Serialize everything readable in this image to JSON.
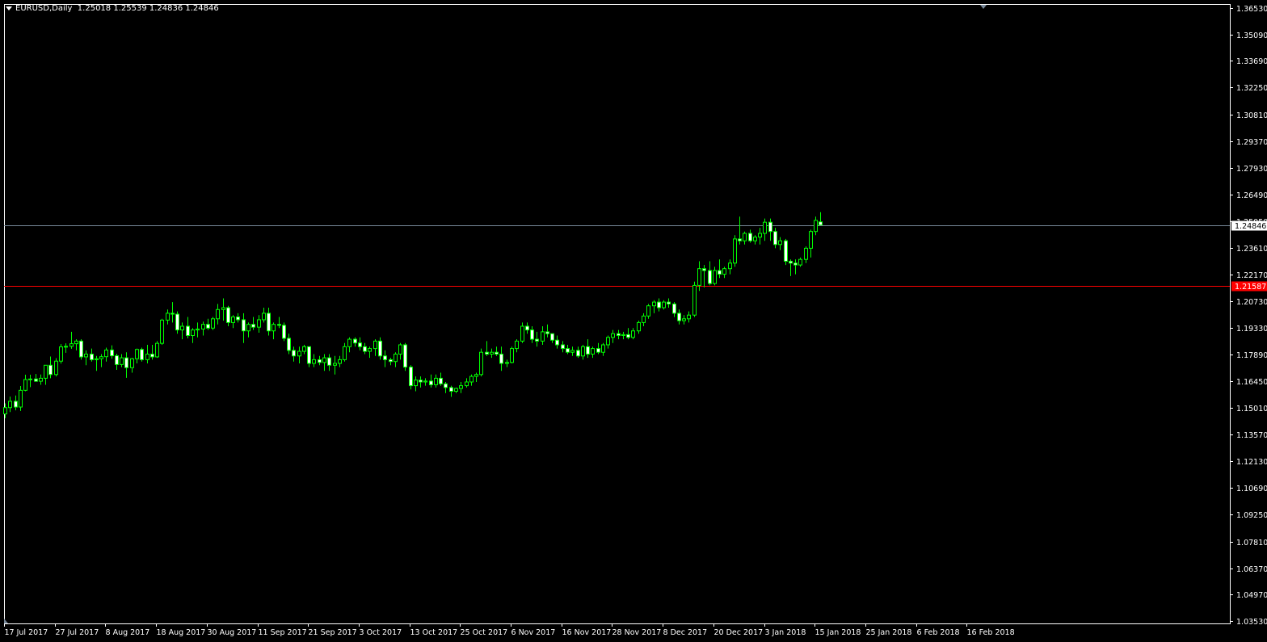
{
  "header": {
    "symbol": "EURUSD,Daily",
    "ohlc": "1.25018 1.25539 1.24836 1.24846"
  },
  "colors": {
    "background": "#000000",
    "frame": "#ffffff",
    "candle_up_fill": "#000000",
    "candle_down_fill": "#ffffff",
    "candle_outline": "#00ff00",
    "bid_line": "#778899",
    "level_line": "#ff0000",
    "level_label_bg": "#ff0000",
    "bid_label_bg": "#ffffff"
  },
  "chart_data": {
    "type": "candlestick",
    "title": "",
    "xlabel": "",
    "ylabel": "",
    "ylim": [
      1.0353,
      1.3653
    ],
    "grid": false,
    "y_ticks": [
      "1.36530",
      "1.35090",
      "1.33690",
      "1.32250",
      "1.30810",
      "1.29370",
      "1.27930",
      "1.26490",
      "1.25050",
      "1.23610",
      "1.22170",
      "1.20730",
      "1.19330",
      "1.17890",
      "1.16450",
      "1.15010",
      "1.13570",
      "1.12130",
      "1.10690",
      "1.09250",
      "1.07810",
      "1.06370",
      "1.04970",
      "1.03530"
    ],
    "x_ticks": [
      "17 Jul 2017",
      "27 Jul 2017",
      "8 Aug 2017",
      "18 Aug 2017",
      "30 Aug 2017",
      "11 Sep 2017",
      "21 Sep 2017",
      "3 Oct 2017",
      "13 Oct 2017",
      "25 Oct 2017",
      "6 Nov 2017",
      "16 Nov 2017",
      "28 Nov 2017",
      "8 Dec 2017",
      "20 Dec 2017",
      "3 Jan 2018",
      "15 Jan 2018",
      "25 Jan 2018",
      "6 Feb 2018",
      "16 Feb 2018"
    ],
    "bid_line": {
      "value": 1.24846,
      "label": "1.24846"
    },
    "level_line": {
      "value": 1.21587,
      "label": "1.21587"
    },
    "candles": [
      {
        "o": 1.1468,
        "h": 1.1525,
        "l": 1.1445,
        "c": 1.1502
      },
      {
        "o": 1.1502,
        "h": 1.1561,
        "l": 1.1478,
        "c": 1.1536
      },
      {
        "o": 1.1536,
        "h": 1.1567,
        "l": 1.1487,
        "c": 1.1505
      },
      {
        "o": 1.1505,
        "h": 1.1618,
        "l": 1.1484,
        "c": 1.1595
      },
      {
        "o": 1.1595,
        "h": 1.1679,
        "l": 1.159,
        "c": 1.1653
      },
      {
        "o": 1.1653,
        "h": 1.1679,
        "l": 1.1612,
        "c": 1.1656
      },
      {
        "o": 1.1656,
        "h": 1.1683,
        "l": 1.164,
        "c": 1.1644
      },
      {
        "o": 1.1644,
        "h": 1.168,
        "l": 1.1625,
        "c": 1.166
      },
      {
        "o": 1.166,
        "h": 1.1722,
        "l": 1.1625,
        "c": 1.173
      },
      {
        "o": 1.173,
        "h": 1.1777,
        "l": 1.166,
        "c": 1.168
      },
      {
        "o": 1.168,
        "h": 1.1768,
        "l": 1.167,
        "c": 1.1752
      },
      {
        "o": 1.1752,
        "h": 1.1844,
        "l": 1.1739,
        "c": 1.1829
      },
      {
        "o": 1.1829,
        "h": 1.1848,
        "l": 1.1797,
        "c": 1.1832
      },
      {
        "o": 1.1832,
        "h": 1.191,
        "l": 1.1819,
        "c": 1.1846
      },
      {
        "o": 1.1846,
        "h": 1.187,
        "l": 1.181,
        "c": 1.186
      },
      {
        "o": 1.186,
        "h": 1.187,
        "l": 1.176,
        "c": 1.1775
      },
      {
        "o": 1.1775,
        "h": 1.181,
        "l": 1.173,
        "c": 1.179
      },
      {
        "o": 1.179,
        "h": 1.182,
        "l": 1.175,
        "c": 1.176
      },
      {
        "o": 1.176,
        "h": 1.178,
        "l": 1.17,
        "c": 1.1765
      },
      {
        "o": 1.1765,
        "h": 1.179,
        "l": 1.172,
        "c": 1.1776
      },
      {
        "o": 1.1776,
        "h": 1.1825,
        "l": 1.175,
        "c": 1.1812
      },
      {
        "o": 1.1812,
        "h": 1.1837,
        "l": 1.1765,
        "c": 1.1781
      },
      {
        "o": 1.1781,
        "h": 1.1792,
        "l": 1.1705,
        "c": 1.1734
      },
      {
        "o": 1.1734,
        "h": 1.179,
        "l": 1.172,
        "c": 1.177
      },
      {
        "o": 1.177,
        "h": 1.18,
        "l": 1.1662,
        "c": 1.1717
      },
      {
        "o": 1.1717,
        "h": 1.177,
        "l": 1.169,
        "c": 1.1765
      },
      {
        "o": 1.1765,
        "h": 1.182,
        "l": 1.174,
        "c": 1.1815
      },
      {
        "o": 1.1815,
        "h": 1.1825,
        "l": 1.175,
        "c": 1.176
      },
      {
        "o": 1.176,
        "h": 1.184,
        "l": 1.174,
        "c": 1.179
      },
      {
        "o": 1.179,
        "h": 1.184,
        "l": 1.176,
        "c": 1.1775
      },
      {
        "o": 1.1775,
        "h": 1.186,
        "l": 1.177,
        "c": 1.1848
      },
      {
        "o": 1.1848,
        "h": 1.198,
        "l": 1.184,
        "c": 1.1973
      },
      {
        "o": 1.1973,
        "h": 1.203,
        "l": 1.195,
        "c": 1.201
      },
      {
        "o": 1.201,
        "h": 1.207,
        "l": 1.196,
        "c": 1.2005
      },
      {
        "o": 1.2005,
        "h": 1.202,
        "l": 1.19,
        "c": 1.192
      },
      {
        "o": 1.192,
        "h": 1.196,
        "l": 1.187,
        "c": 1.194
      },
      {
        "o": 1.194,
        "h": 1.199,
        "l": 1.1875,
        "c": 1.189
      },
      {
        "o": 1.189,
        "h": 1.193,
        "l": 1.185,
        "c": 1.192
      },
      {
        "o": 1.192,
        "h": 1.196,
        "l": 1.188,
        "c": 1.1925
      },
      {
        "o": 1.1925,
        "h": 1.1965,
        "l": 1.189,
        "c": 1.195
      },
      {
        "o": 1.195,
        "h": 1.198,
        "l": 1.192,
        "c": 1.193
      },
      {
        "o": 1.193,
        "h": 1.199,
        "l": 1.192,
        "c": 1.198
      },
      {
        "o": 1.198,
        "h": 1.206,
        "l": 1.195,
        "c": 1.203
      },
      {
        "o": 1.203,
        "h": 1.209,
        "l": 1.197,
        "c": 1.204
      },
      {
        "o": 1.204,
        "h": 1.205,
        "l": 1.194,
        "c": 1.196
      },
      {
        "o": 1.196,
        "h": 1.2,
        "l": 1.193,
        "c": 1.199
      },
      {
        "o": 1.199,
        "h": 1.201,
        "l": 1.196,
        "c": 1.1975
      },
      {
        "o": 1.1975,
        "h": 1.201,
        "l": 1.185,
        "c": 1.1915
      },
      {
        "o": 1.1915,
        "h": 1.196,
        "l": 1.188,
        "c": 1.195
      },
      {
        "o": 1.195,
        "h": 1.199,
        "l": 1.192,
        "c": 1.1935
      },
      {
        "o": 1.1935,
        "h": 1.2,
        "l": 1.1905,
        "c": 1.1975
      },
      {
        "o": 1.1975,
        "h": 1.204,
        "l": 1.196,
        "c": 1.201
      },
      {
        "o": 1.201,
        "h": 1.204,
        "l": 1.189,
        "c": 1.1915
      },
      {
        "o": 1.1915,
        "h": 1.196,
        "l": 1.187,
        "c": 1.195
      },
      {
        "o": 1.195,
        "h": 1.199,
        "l": 1.193,
        "c": 1.1945
      },
      {
        "o": 1.1945,
        "h": 1.196,
        "l": 1.186,
        "c": 1.1875
      },
      {
        "o": 1.1875,
        "h": 1.19,
        "l": 1.179,
        "c": 1.181
      },
      {
        "o": 1.181,
        "h": 1.183,
        "l": 1.175,
        "c": 1.178
      },
      {
        "o": 1.178,
        "h": 1.183,
        "l": 1.174,
        "c": 1.1805
      },
      {
        "o": 1.1805,
        "h": 1.184,
        "l": 1.179,
        "c": 1.183
      },
      {
        "o": 1.183,
        "h": 1.183,
        "l": 1.172,
        "c": 1.174
      },
      {
        "o": 1.174,
        "h": 1.179,
        "l": 1.172,
        "c": 1.176
      },
      {
        "o": 1.176,
        "h": 1.178,
        "l": 1.173,
        "c": 1.1745
      },
      {
        "o": 1.1745,
        "h": 1.179,
        "l": 1.17,
        "c": 1.177
      },
      {
        "o": 1.177,
        "h": 1.179,
        "l": 1.17,
        "c": 1.173
      },
      {
        "o": 1.173,
        "h": 1.178,
        "l": 1.168,
        "c": 1.174
      },
      {
        "o": 1.174,
        "h": 1.178,
        "l": 1.172,
        "c": 1.176
      },
      {
        "o": 1.176,
        "h": 1.185,
        "l": 1.175,
        "c": 1.183
      },
      {
        "o": 1.183,
        "h": 1.188,
        "l": 1.18,
        "c": 1.187
      },
      {
        "o": 1.187,
        "h": 1.188,
        "l": 1.183,
        "c": 1.185
      },
      {
        "o": 1.185,
        "h": 1.188,
        "l": 1.181,
        "c": 1.183
      },
      {
        "o": 1.183,
        "h": 1.185,
        "l": 1.179,
        "c": 1.1805
      },
      {
        "o": 1.1805,
        "h": 1.183,
        "l": 1.177,
        "c": 1.182
      },
      {
        "o": 1.182,
        "h": 1.187,
        "l": 1.178,
        "c": 1.186
      },
      {
        "o": 1.186,
        "h": 1.188,
        "l": 1.176,
        "c": 1.178
      },
      {
        "o": 1.178,
        "h": 1.181,
        "l": 1.172,
        "c": 1.176
      },
      {
        "o": 1.176,
        "h": 1.177,
        "l": 1.173,
        "c": 1.175
      },
      {
        "o": 1.175,
        "h": 1.18,
        "l": 1.172,
        "c": 1.179
      },
      {
        "o": 1.179,
        "h": 1.185,
        "l": 1.176,
        "c": 1.184
      },
      {
        "o": 1.184,
        "h": 1.185,
        "l": 1.17,
        "c": 1.172
      },
      {
        "o": 1.172,
        "h": 1.173,
        "l": 1.16,
        "c": 1.162
      },
      {
        "o": 1.162,
        "h": 1.167,
        "l": 1.159,
        "c": 1.165
      },
      {
        "o": 1.165,
        "h": 1.167,
        "l": 1.161,
        "c": 1.164
      },
      {
        "o": 1.164,
        "h": 1.166,
        "l": 1.162,
        "c": 1.1645
      },
      {
        "o": 1.1645,
        "h": 1.168,
        "l": 1.161,
        "c": 1.1625
      },
      {
        "o": 1.1625,
        "h": 1.168,
        "l": 1.161,
        "c": 1.166
      },
      {
        "o": 1.166,
        "h": 1.169,
        "l": 1.162,
        "c": 1.163
      },
      {
        "o": 1.163,
        "h": 1.164,
        "l": 1.158,
        "c": 1.161
      },
      {
        "o": 1.161,
        "h": 1.162,
        "l": 1.156,
        "c": 1.159
      },
      {
        "o": 1.159,
        "h": 1.161,
        "l": 1.158,
        "c": 1.1605
      },
      {
        "o": 1.1605,
        "h": 1.164,
        "l": 1.158,
        "c": 1.162
      },
      {
        "o": 1.162,
        "h": 1.166,
        "l": 1.161,
        "c": 1.164
      },
      {
        "o": 1.164,
        "h": 1.168,
        "l": 1.162,
        "c": 1.167
      },
      {
        "o": 1.167,
        "h": 1.169,
        "l": 1.164,
        "c": 1.168
      },
      {
        "o": 1.168,
        "h": 1.182,
        "l": 1.167,
        "c": 1.18
      },
      {
        "o": 1.18,
        "h": 1.186,
        "l": 1.178,
        "c": 1.179
      },
      {
        "o": 1.179,
        "h": 1.182,
        "l": 1.177,
        "c": 1.18
      },
      {
        "o": 1.18,
        "h": 1.183,
        "l": 1.178,
        "c": 1.179
      },
      {
        "o": 1.179,
        "h": 1.183,
        "l": 1.17,
        "c": 1.174
      },
      {
        "o": 1.174,
        "h": 1.176,
        "l": 1.172,
        "c": 1.1745
      },
      {
        "o": 1.1745,
        "h": 1.183,
        "l": 1.174,
        "c": 1.182
      },
      {
        "o": 1.182,
        "h": 1.187,
        "l": 1.18,
        "c": 1.186
      },
      {
        "o": 1.186,
        "h": 1.196,
        "l": 1.185,
        "c": 1.194
      },
      {
        "o": 1.194,
        "h": 1.196,
        "l": 1.19,
        "c": 1.192
      },
      {
        "o": 1.192,
        "h": 1.194,
        "l": 1.185,
        "c": 1.187
      },
      {
        "o": 1.187,
        "h": 1.191,
        "l": 1.183,
        "c": 1.186
      },
      {
        "o": 1.186,
        "h": 1.194,
        "l": 1.184,
        "c": 1.191
      },
      {
        "o": 1.191,
        "h": 1.195,
        "l": 1.188,
        "c": 1.19
      },
      {
        "o": 1.19,
        "h": 1.19,
        "l": 1.185,
        "c": 1.1865
      },
      {
        "o": 1.1865,
        "h": 1.189,
        "l": 1.182,
        "c": 1.184
      },
      {
        "o": 1.184,
        "h": 1.186,
        "l": 1.18,
        "c": 1.182
      },
      {
        "o": 1.182,
        "h": 1.184,
        "l": 1.179,
        "c": 1.18
      },
      {
        "o": 1.18,
        "h": 1.183,
        "l": 1.178,
        "c": 1.181
      },
      {
        "o": 1.181,
        "h": 1.183,
        "l": 1.177,
        "c": 1.178
      },
      {
        "o": 1.178,
        "h": 1.184,
        "l": 1.176,
        "c": 1.183
      },
      {
        "o": 1.183,
        "h": 1.187,
        "l": 1.177,
        "c": 1.179
      },
      {
        "o": 1.179,
        "h": 1.183,
        "l": 1.177,
        "c": 1.182
      },
      {
        "o": 1.182,
        "h": 1.185,
        "l": 1.179,
        "c": 1.18
      },
      {
        "o": 1.18,
        "h": 1.185,
        "l": 1.178,
        "c": 1.184
      },
      {
        "o": 1.184,
        "h": 1.189,
        "l": 1.182,
        "c": 1.188
      },
      {
        "o": 1.188,
        "h": 1.192,
        "l": 1.185,
        "c": 1.19
      },
      {
        "o": 1.19,
        "h": 1.192,
        "l": 1.187,
        "c": 1.189
      },
      {
        "o": 1.189,
        "h": 1.191,
        "l": 1.187,
        "c": 1.1895
      },
      {
        "o": 1.1895,
        "h": 1.193,
        "l": 1.187,
        "c": 1.188
      },
      {
        "o": 1.188,
        "h": 1.193,
        "l": 1.187,
        "c": 1.1915
      },
      {
        "o": 1.1915,
        "h": 1.197,
        "l": 1.19,
        "c": 1.196
      },
      {
        "o": 1.196,
        "h": 1.201,
        "l": 1.194,
        "c": 1.1995
      },
      {
        "o": 1.1995,
        "h": 1.206,
        "l": 1.198,
        "c": 1.205
      },
      {
        "o": 1.205,
        "h": 1.208,
        "l": 1.201,
        "c": 1.207
      },
      {
        "o": 1.207,
        "h": 1.209,
        "l": 1.202,
        "c": 1.204
      },
      {
        "o": 1.204,
        "h": 1.208,
        "l": 1.203,
        "c": 1.207
      },
      {
        "o": 1.207,
        "h": 1.209,
        "l": 1.204,
        "c": 1.206
      },
      {
        "o": 1.206,
        "h": 1.207,
        "l": 1.199,
        "c": 1.201
      },
      {
        "o": 1.201,
        "h": 1.203,
        "l": 1.195,
        "c": 1.197
      },
      {
        "o": 1.197,
        "h": 1.2,
        "l": 1.195,
        "c": 1.198
      },
      {
        "o": 1.198,
        "h": 1.202,
        "l": 1.196,
        "c": 1.2
      },
      {
        "o": 1.2,
        "h": 1.218,
        "l": 1.199,
        "c": 1.216
      },
      {
        "o": 1.216,
        "h": 1.229,
        "l": 1.213,
        "c": 1.225
      },
      {
        "o": 1.225,
        "h": 1.227,
        "l": 1.215,
        "c": 1.224
      },
      {
        "o": 1.224,
        "h": 1.229,
        "l": 1.216,
        "c": 1.217
      },
      {
        "o": 1.217,
        "h": 1.226,
        "l": 1.216,
        "c": 1.224
      },
      {
        "o": 1.224,
        "h": 1.23,
        "l": 1.22,
        "c": 1.222
      },
      {
        "o": 1.222,
        "h": 1.226,
        "l": 1.22,
        "c": 1.225
      },
      {
        "o": 1.225,
        "h": 1.23,
        "l": 1.222,
        "c": 1.228
      },
      {
        "o": 1.228,
        "h": 1.243,
        "l": 1.226,
        "c": 1.241
      },
      {
        "o": 1.241,
        "h": 1.253,
        "l": 1.238,
        "c": 1.24
      },
      {
        "o": 1.24,
        "h": 1.245,
        "l": 1.238,
        "c": 1.244
      },
      {
        "o": 1.244,
        "h": 1.246,
        "l": 1.239,
        "c": 1.24
      },
      {
        "o": 1.24,
        "h": 1.243,
        "l": 1.238,
        "c": 1.242
      },
      {
        "o": 1.242,
        "h": 1.247,
        "l": 1.238,
        "c": 1.244
      },
      {
        "o": 1.244,
        "h": 1.252,
        "l": 1.24,
        "c": 1.25
      },
      {
        "o": 1.25,
        "h": 1.252,
        "l": 1.24,
        "c": 1.245
      },
      {
        "o": 1.245,
        "h": 1.247,
        "l": 1.236,
        "c": 1.238
      },
      {
        "o": 1.238,
        "h": 1.242,
        "l": 1.235,
        "c": 1.24
      },
      {
        "o": 1.24,
        "h": 1.241,
        "l": 1.227,
        "c": 1.229
      },
      {
        "o": 1.229,
        "h": 1.23,
        "l": 1.221,
        "c": 1.228
      },
      {
        "o": 1.228,
        "h": 1.23,
        "l": 1.222,
        "c": 1.227
      },
      {
        "o": 1.227,
        "h": 1.231,
        "l": 1.226,
        "c": 1.23
      },
      {
        "o": 1.23,
        "h": 1.237,
        "l": 1.228,
        "c": 1.236
      },
      {
        "o": 1.236,
        "h": 1.246,
        "l": 1.231,
        "c": 1.245
      },
      {
        "o": 1.245,
        "h": 1.253,
        "l": 1.243,
        "c": 1.251
      },
      {
        "o": 1.2502,
        "h": 1.2554,
        "l": 1.2484,
        "c": 1.2485
      }
    ]
  }
}
